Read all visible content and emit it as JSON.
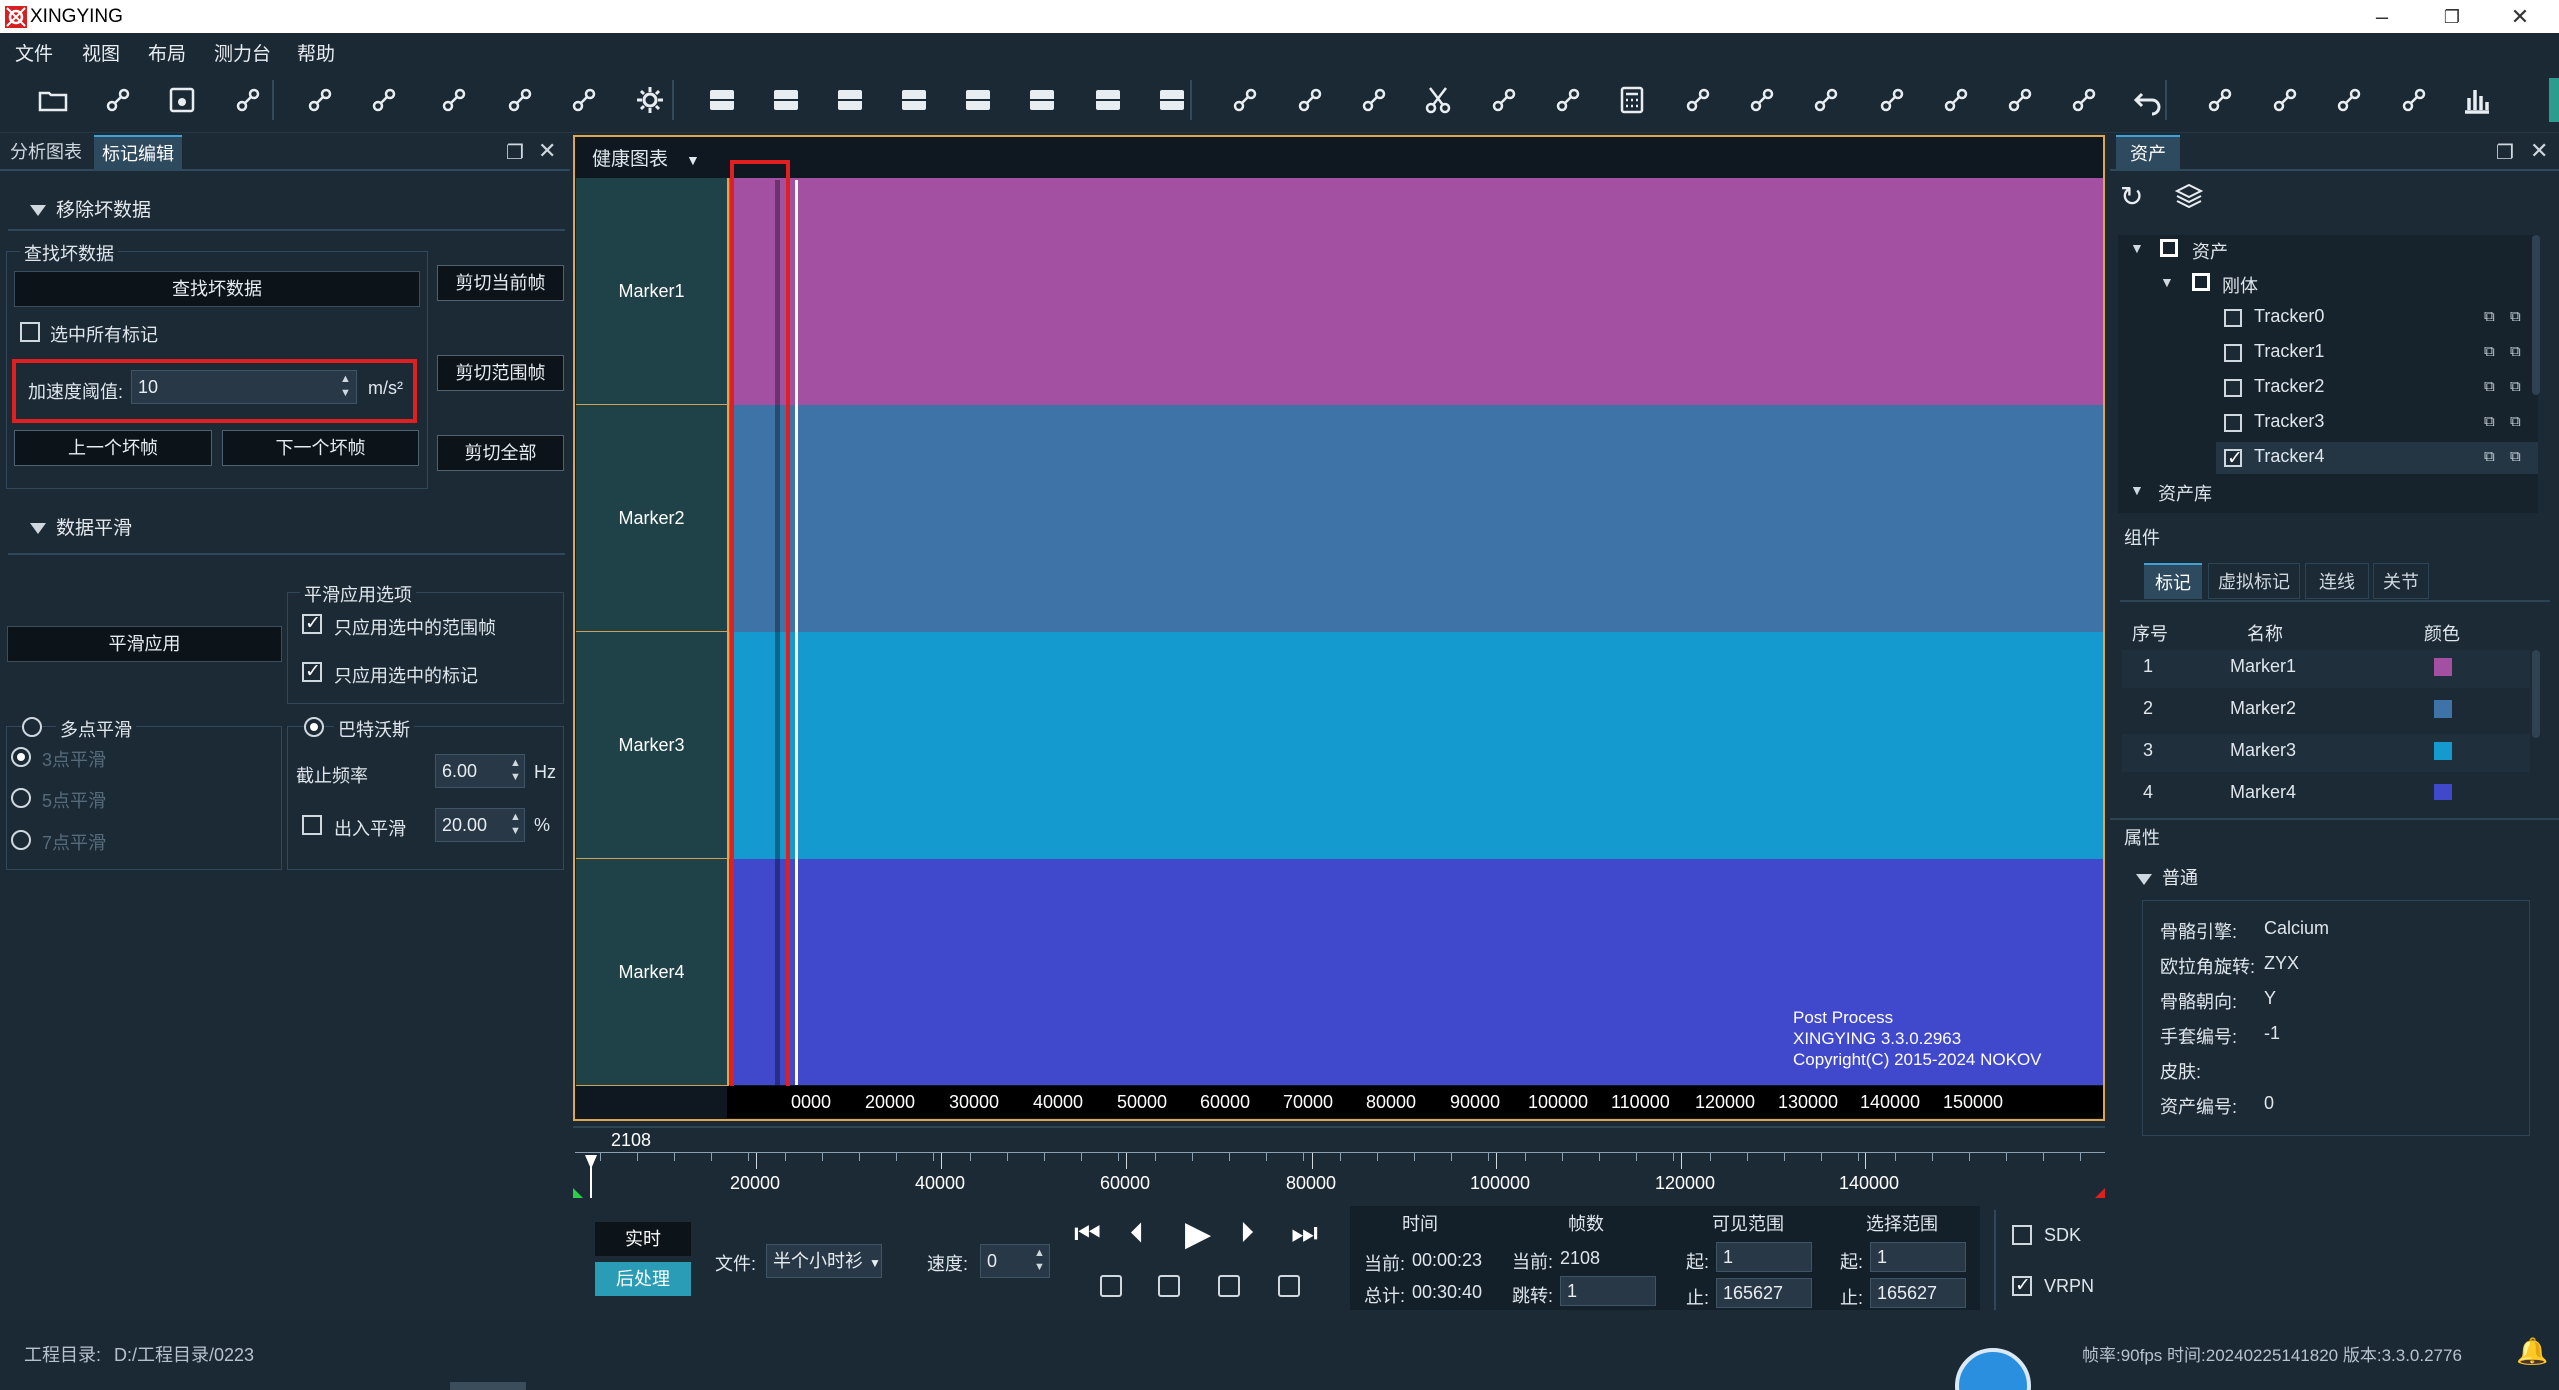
{
  "app": {
    "title": "XINGYING"
  },
  "menu": [
    "文件",
    "视图",
    "布局",
    "测力台",
    "帮助"
  ],
  "colors": {
    "marker1": "#a350a3",
    "marker2": "#3d73a6",
    "marker3": "#159ad0",
    "marker4": "#4048cc",
    "accent": "#3da2d8",
    "highlight_box": "#e02020",
    "graph_border": "#e0a64a"
  },
  "toolbar_icons": [
    "folder-open-icon",
    "import-icon",
    "save-icon",
    "export-icon",
    "eye-off-icon",
    "camera-rotate-icon",
    "layers-icon",
    "camera-icon",
    "edit-icon",
    "settings-icon",
    "layout-single-icon",
    "layout-two-row-icon",
    "layout-two-col-icon",
    "layout-three-a-icon",
    "layout-three-b-icon",
    "layout-three-c-icon",
    "layout-three-d-icon",
    "layout-four-icon",
    "link-icon",
    "merge-icon",
    "connect-icon",
    "cut-icon",
    "bone-icon",
    "line-icon",
    "calculator-icon",
    "bulb-icon",
    "cross-icon",
    "wave-icon",
    "trim-icon",
    "select-box-icon",
    "target-icon",
    "run-icon",
    "undo-icon",
    "refresh-camera-icon",
    "3d-icon",
    "gauge-icon",
    "share-icon",
    "bar-chart-icon"
  ],
  "left_panel": {
    "tabs": [
      "分析图表",
      "标记编辑"
    ],
    "remove_bad": {
      "header": "移除坏数据",
      "find_group": "查找坏数据",
      "find_button": "查找坏数据",
      "select_all_markers": "选中所有标记",
      "accel_label": "加速度阈值:",
      "accel_value": "10",
      "accel_unit": "m/s²",
      "prev_bad": "上一个坏帧",
      "next_bad": "下一个坏帧",
      "cut_current": "剪切当前帧",
      "cut_range": "剪切范围帧",
      "cut_all": "剪切全部"
    },
    "smooth": {
      "header": "数据平滑",
      "apply_button": "平滑应用",
      "options_title": "平滑应用选项",
      "opt_range_frames": "只应用选中的范围帧",
      "opt_selected_markers": "只应用选中的标记",
      "multi_point": "多点平滑",
      "p3": "3点平滑",
      "p5": "5点平滑",
      "p7": "7点平滑",
      "butterworth": "巴特沃斯",
      "cutoff_label": "截止频率",
      "cutoff_value": "6.00",
      "cutoff_unit": "Hz",
      "inout_label": "出入平滑",
      "inout_value": "20.00",
      "inout_unit": "%"
    }
  },
  "graph": {
    "dropdown": "健康图表",
    "markers": [
      "Marker1",
      "Marker2",
      "Marker3",
      "Marker4"
    ],
    "watermark": [
      "Post Process",
      "XINGYING 3.3.0.2963",
      "Copyright(C) 2015-2024 NOKOV"
    ],
    "x_ticks": [
      "0000",
      "20000",
      "30000",
      "40000",
      "50000",
      "60000",
      "70000",
      "80000",
      "90000",
      "100000",
      "110000",
      "120000",
      "130000",
      "140000",
      "150000"
    ]
  },
  "timeline": {
    "current_frame": "2108",
    "ticks": [
      "20000",
      "40000",
      "60000",
      "80000",
      "100000",
      "120000",
      "140000"
    ]
  },
  "playback": {
    "realtime": "实时",
    "postprocess": "后处理",
    "file_label": "文件:",
    "file_value": "半个小时衫",
    "speed_label": "速度:",
    "speed_value": "0",
    "time_header": "时间",
    "time_current_label": "当前:",
    "time_current": "00:00:23",
    "time_total_label": "总计:",
    "time_total": "00:30:40",
    "frame_header": "帧数",
    "frame_current_label": "当前:",
    "frame_current": "2108",
    "frame_jump_label": "跳转:",
    "frame_jump": "1",
    "visible_header": "可见范围",
    "visible_start_label": "起:",
    "visible_start": "1",
    "visible_end_label": "止:",
    "visible_end": "165627",
    "select_header": "选择范围",
    "select_start_label": "起:",
    "select_start": "1",
    "select_end_label": "止:",
    "select_end": "165627",
    "sdk": "SDK",
    "vrpn": "VRPN"
  },
  "right_panel": {
    "tab": "资产",
    "tree": {
      "root": "资产",
      "rigid": "刚体",
      "trackers": [
        "Tracker0",
        "Tracker1",
        "Tracker2",
        "Tracker3",
        "Tracker4"
      ],
      "library": "资产库"
    },
    "component_title": "组件",
    "sub_tabs": [
      "标记",
      "虚拟标记",
      "连线",
      "关节"
    ],
    "table_headers": [
      "序号",
      "名称",
      "颜色"
    ],
    "rows": [
      {
        "idx": "1",
        "name": "Marker1",
        "color": "#a350a3"
      },
      {
        "idx": "2",
        "name": "Marker2",
        "color": "#3d73a6"
      },
      {
        "idx": "3",
        "name": "Marker3",
        "color": "#159ad0"
      },
      {
        "idx": "4",
        "name": "Marker4",
        "color": "#4048cc"
      }
    ],
    "attr_title": "属性",
    "general": "普通",
    "props": [
      {
        "k": "骨骼引擎:",
        "v": "Calcium"
      },
      {
        "k": "欧拉角旋转:",
        "v": "ZYX"
      },
      {
        "k": "骨骼朝向:",
        "v": "Y"
      },
      {
        "k": "手套编号:",
        "v": "-1"
      },
      {
        "k": "皮肤:",
        "v": ""
      },
      {
        "k": "资产编号:",
        "v": "0"
      }
    ]
  },
  "status": {
    "project_label": "工程目录:",
    "project_path": "D:/工程目录/0223",
    "right": "帧率:90fps 时间:20240225141820 版本:3.3.0.2776"
  }
}
